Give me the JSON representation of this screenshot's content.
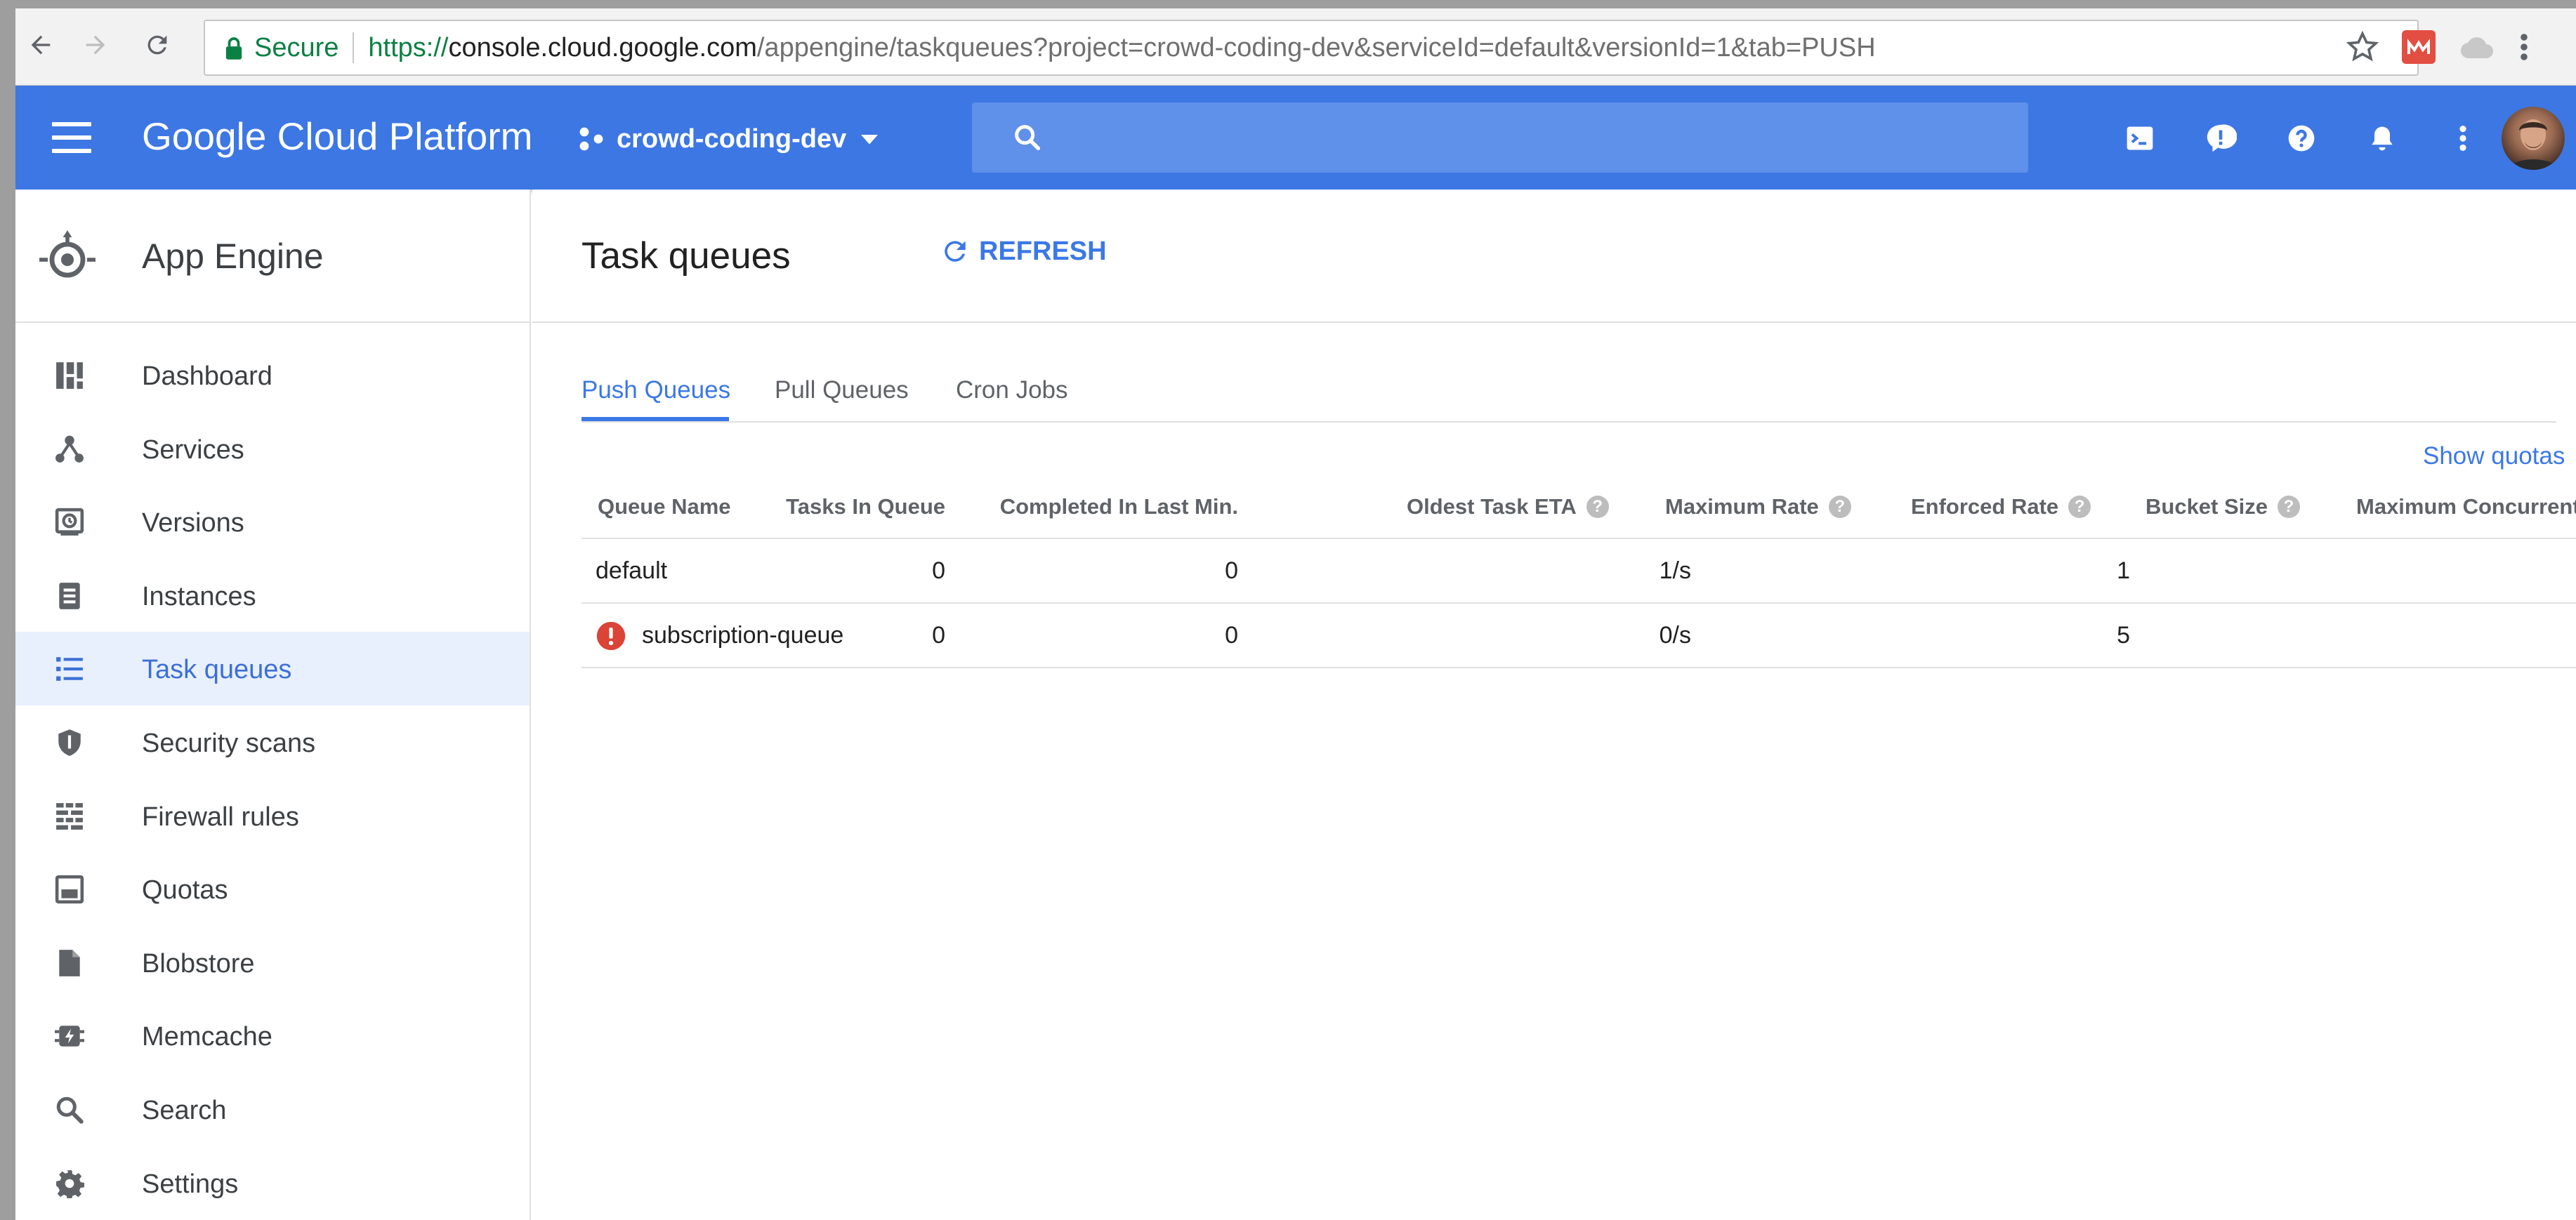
{
  "browser": {
    "secure_label": "Secure",
    "url_scheme": "https://",
    "url_host": "console.cloud.google.com",
    "url_path": "/appengine/taskqueues?project=crowd-coding-dev&serviceId=default&versionId=1&tab=PUSH"
  },
  "topbar": {
    "brand": "Google Cloud Platform",
    "project": "crowd-coding-dev",
    "accent_color": "#3d77e3"
  },
  "sidebar": {
    "product": "App Engine",
    "items": [
      {
        "label": "Dashboard",
        "icon": "dashboard-icon"
      },
      {
        "label": "Services",
        "icon": "services-icon"
      },
      {
        "label": "Versions",
        "icon": "versions-icon"
      },
      {
        "label": "Instances",
        "icon": "instances-icon"
      },
      {
        "label": "Task queues",
        "icon": "task-queues-icon",
        "active": true
      },
      {
        "label": "Security scans",
        "icon": "shield-icon"
      },
      {
        "label": "Firewall rules",
        "icon": "firewall-icon"
      },
      {
        "label": "Quotas",
        "icon": "quotas-icon"
      },
      {
        "label": "Blobstore",
        "icon": "file-icon"
      },
      {
        "label": "Memcache",
        "icon": "memcache-icon"
      },
      {
        "label": "Search",
        "icon": "search-icon"
      },
      {
        "label": "Settings",
        "icon": "gear-icon"
      }
    ]
  },
  "main": {
    "title": "Task queues",
    "refresh_label": "REFRESH",
    "tabs": [
      {
        "label": "Push Queues",
        "active": true
      },
      {
        "label": "Pull Queues"
      },
      {
        "label": "Cron Jobs"
      }
    ],
    "show_quotas": "Show quotas",
    "table": {
      "columns": [
        "Queue Name",
        "Tasks In Queue",
        "Completed In Last Min.",
        "Oldest Task ETA",
        "Maximum Rate",
        "Enforced Rate",
        "Bucket Size",
        "Maximum Concurrent"
      ],
      "rows": [
        {
          "name": "default",
          "tasks": "0",
          "completed": "0",
          "oldest_eta": "",
          "max_rate": "1/s",
          "enforced_rate": "",
          "bucket_size": "1",
          "max_concurrent": "",
          "warning": false
        },
        {
          "name": "subscription-queue",
          "tasks": "0",
          "completed": "0",
          "oldest_eta": "",
          "max_rate": "0/s",
          "enforced_rate": "",
          "bucket_size": "5",
          "max_concurrent": "",
          "warning": true
        }
      ]
    }
  }
}
